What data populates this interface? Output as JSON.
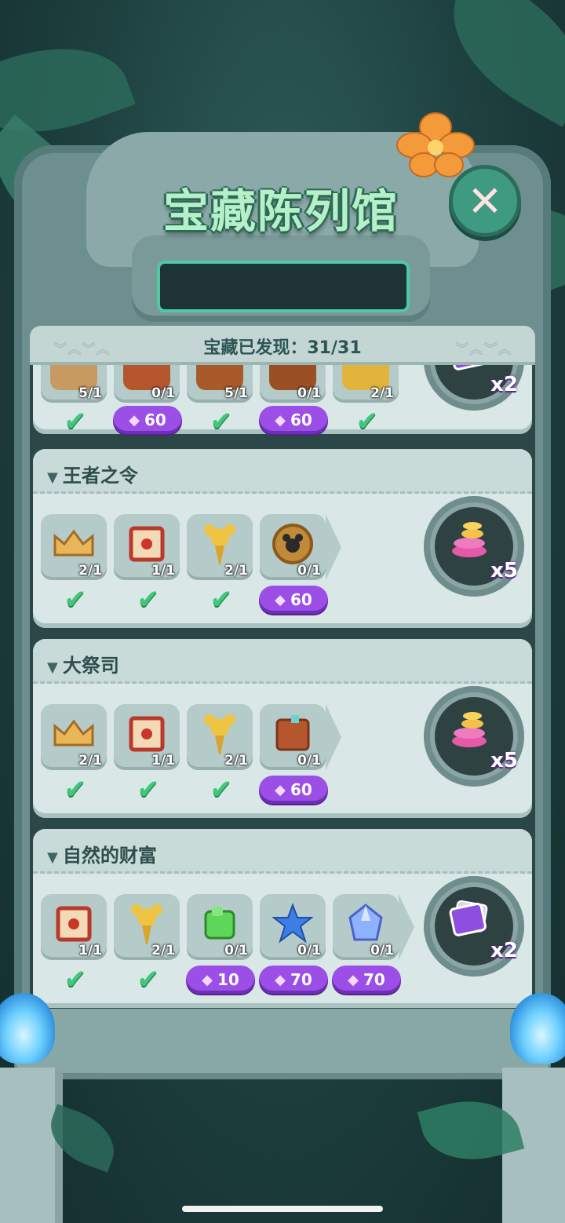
{
  "title": "宝藏陈列馆",
  "header": {
    "discovered_label": "宝藏已发现：31/31"
  },
  "top_partial_row": {
    "items": [
      {
        "count": "5/1",
        "status": "check"
      },
      {
        "count": "0/1",
        "status": "gem",
        "cost": "60"
      },
      {
        "count": "5/1",
        "status": "check"
      },
      {
        "count": "0/1",
        "status": "gem",
        "cost": "60"
      },
      {
        "count": "2/1",
        "status": "check"
      }
    ],
    "reward_mult": "x2"
  },
  "collections": [
    {
      "name": "王者之令",
      "items": [
        {
          "icon": "crown-icon",
          "count": "2/1",
          "status": "check"
        },
        {
          "icon": "scroll-icon",
          "count": "1/1",
          "status": "check"
        },
        {
          "icon": "mickey-scepter-icon",
          "count": "2/1",
          "status": "check"
        },
        {
          "icon": "mickey-medallion-icon",
          "count": "0/1",
          "status": "gem",
          "cost": "60"
        }
      ],
      "reward_mult": "x5",
      "reward_icon": "coin-stack-icon"
    },
    {
      "name": "大祭司",
      "items": [
        {
          "icon": "crown-icon",
          "count": "2/1",
          "status": "check"
        },
        {
          "icon": "scroll-icon",
          "count": "1/1",
          "status": "check"
        },
        {
          "icon": "mickey-scepter-icon",
          "count": "2/1",
          "status": "check"
        },
        {
          "icon": "book-icon",
          "count": "0/1",
          "status": "gem",
          "cost": "60"
        }
      ],
      "reward_mult": "x5",
      "reward_icon": "coin-stack-icon"
    },
    {
      "name": "自然的财富",
      "items": [
        {
          "icon": "scroll-icon",
          "count": "1/1",
          "status": "check"
        },
        {
          "icon": "mickey-scepter-icon",
          "count": "2/1",
          "status": "check"
        },
        {
          "icon": "green-cube-icon",
          "count": "0/1",
          "status": "gem",
          "cost": "10"
        },
        {
          "icon": "blue-star-gem-icon",
          "count": "0/1",
          "status": "gem",
          "cost": "70"
        },
        {
          "icon": "crystal-icon",
          "count": "0/1",
          "status": "gem",
          "cost": "70"
        }
      ],
      "reward_mult": "x2",
      "reward_icon": "card-pack-icon"
    }
  ],
  "colors": {
    "check": "#41c77b",
    "gem_button": "#9b4fe6",
    "title": "#b6f0c9"
  }
}
